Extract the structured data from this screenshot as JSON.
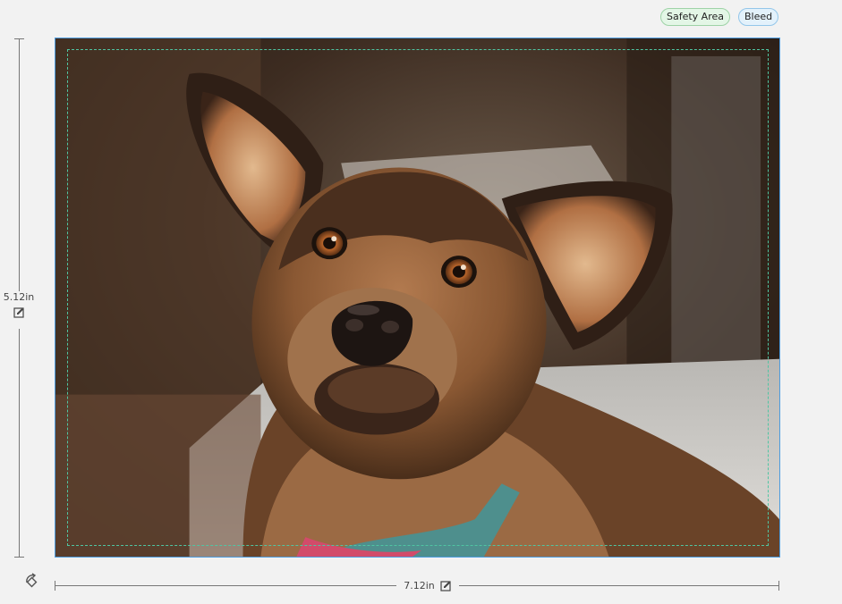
{
  "toggles": {
    "safety_area_label": "Safety Area",
    "bleed_label": "Bleed"
  },
  "dimensions": {
    "height_label": "5.12in",
    "width_label": "7.12in"
  },
  "colors": {
    "frame_border": "#4d9de0",
    "safety_line": "#4fc5a2",
    "safety_pill_bg": "#e3f6e6",
    "bleed_pill_bg": "#e3f1fb"
  },
  "icons": {
    "edit": "edit-icon",
    "rotate": "rotate-icon"
  }
}
